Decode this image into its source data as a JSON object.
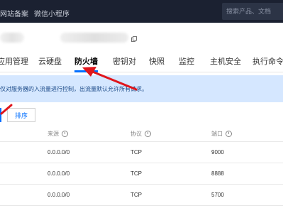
{
  "topbar": {
    "nav_items": [
      "网站备案",
      "微信小程序"
    ],
    "search_placeholder": "搜索产品、文档"
  },
  "tabs": [
    {
      "label": "应用管理",
      "active": false
    },
    {
      "label": "云硬盘",
      "active": false
    },
    {
      "label": "防火墙",
      "active": true
    },
    {
      "label": "密钥对",
      "active": false
    },
    {
      "label": "快照",
      "active": false
    },
    {
      "label": "监控",
      "active": false
    },
    {
      "label": "主机安全",
      "active": false
    },
    {
      "label": "执行命令",
      "active": false
    }
  ],
  "notice": {
    "text": "仅对服务器的入流量进行控制，出流量默认允许所有请求。"
  },
  "toolbar": {
    "sort_label": "排序"
  },
  "table": {
    "headers": {
      "source": "来源",
      "protocol": "协议",
      "port": "端口"
    },
    "rows": [
      {
        "source": "0.0.0.0/0",
        "protocol": "TCP",
        "port": "9000"
      },
      {
        "source": "0.0.0.0/0",
        "protocol": "TCP",
        "port": "8888"
      },
      {
        "source": "0.0.0.0/0",
        "protocol": "TCP",
        "port": "5700"
      }
    ]
  },
  "colors": {
    "topbar_bg": "#1b2131",
    "accent": "#006eff",
    "notice_bg": "#d5e7ff",
    "annotation_arrow": "#e0151b"
  },
  "icons": {
    "copy": "copy-icon",
    "info": "info-circle-icon",
    "annotation": "red-arrow-annotation"
  }
}
